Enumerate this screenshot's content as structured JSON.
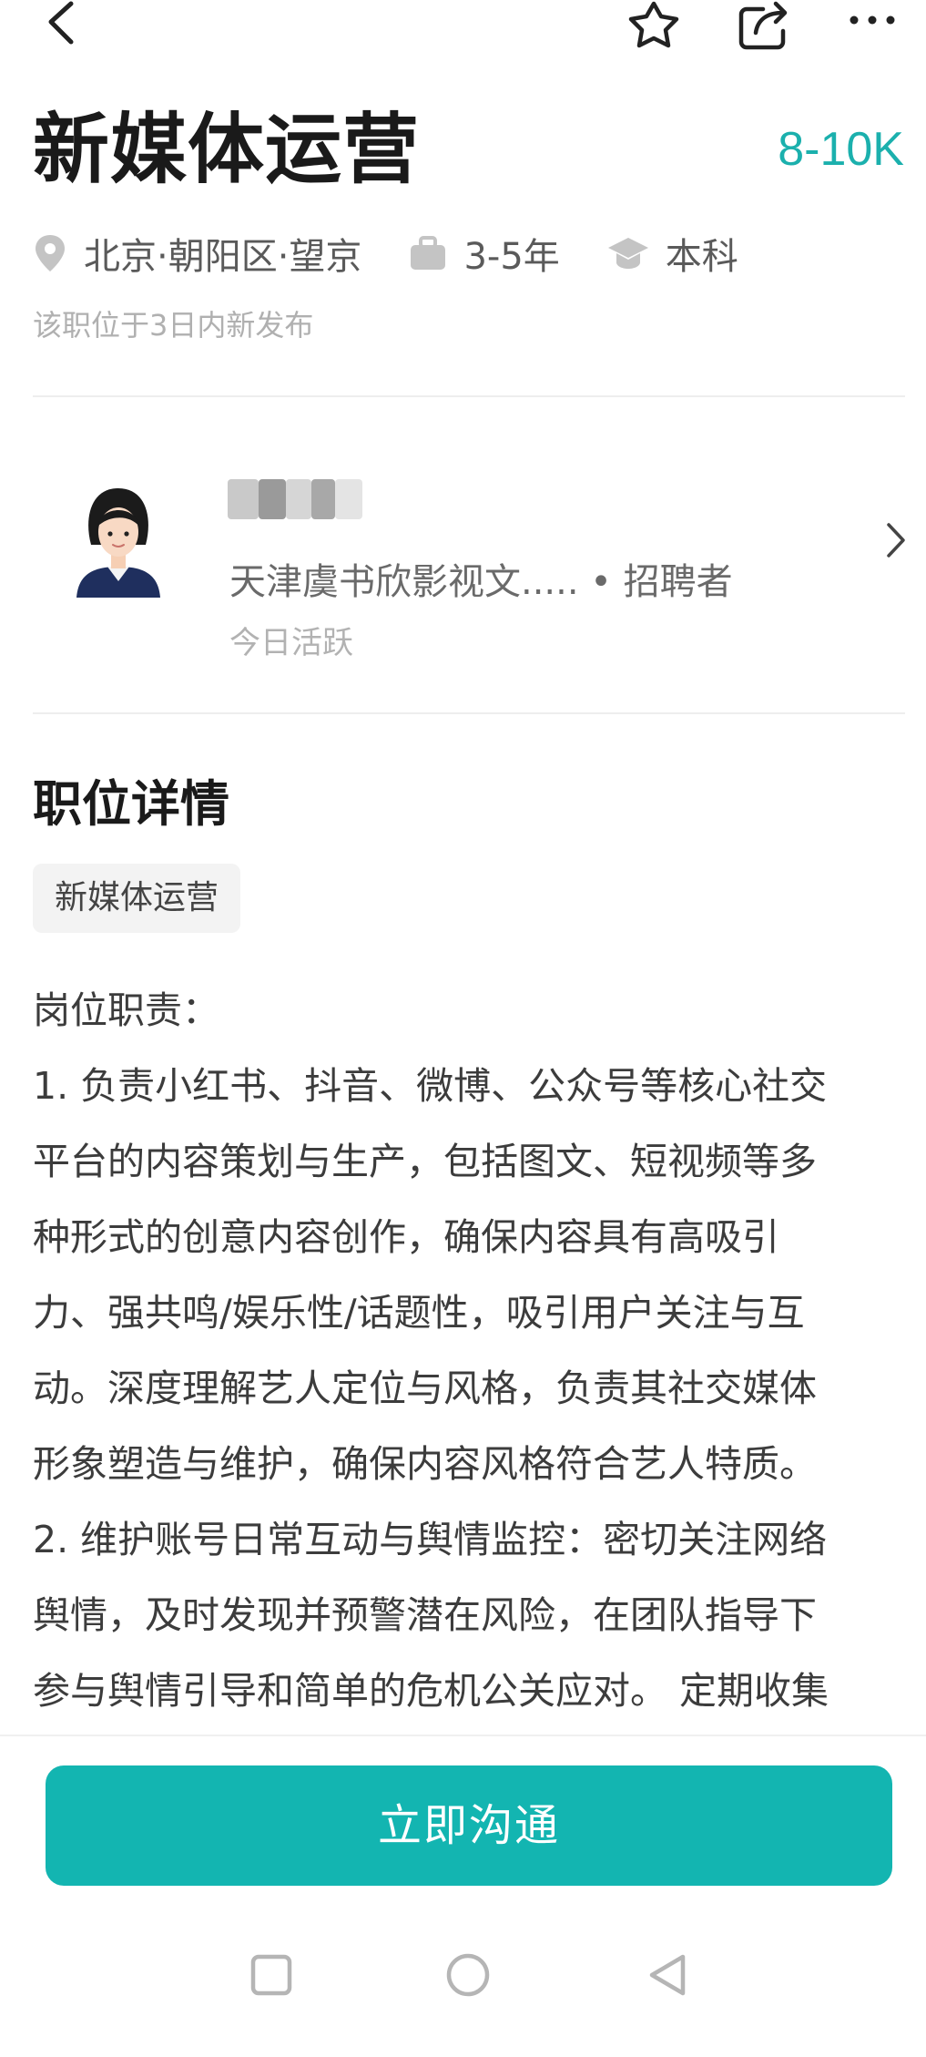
{
  "header": {
    "title": "新媒体运营",
    "salary": "8-10K",
    "location": "北京·朝阳区·望京",
    "experience": "3-5年",
    "education": "本科",
    "posted_note": "该职位于3日内新发布"
  },
  "recruiter": {
    "company_role": "天津虞书欣影视文..... • 招聘者",
    "active_status": "今日活跃"
  },
  "job_detail": {
    "section_title": "职位详情",
    "tag": "新媒体运营",
    "lines": [
      "岗位职责：",
      "1. 负责小红书、抖音、微博、公众号等核心社交",
      "平台的内容策划与生产，包括图文、短视频等多",
      "种形式的创意内容创作，确保内容具有高吸引",
      "力、强共鸣/娱乐性/话题性，吸引用户关注与互",
      "动。深度理解艺人定位与风格，负责其社交媒体",
      "形象塑造与维护，确保内容风格符合艺人特质。",
      "2. 维护账号日常互动与舆情监控：密切关注网络",
      "舆情，及时发现并预警潜在风险，在团队指导下",
      "参与舆情引导和简单的危机公关应对。 定期收集"
    ]
  },
  "actions": {
    "chat_button": "立即沟通"
  },
  "icons": {
    "back": "back-icon",
    "favorite": "star-icon",
    "share": "share-icon",
    "more": "more-icon",
    "location": "location-pin-icon",
    "experience": "briefcase-icon",
    "education": "graduation-cap-icon"
  },
  "colors": {
    "accent": "#13b5b1",
    "salary": "#1bb0ad"
  }
}
